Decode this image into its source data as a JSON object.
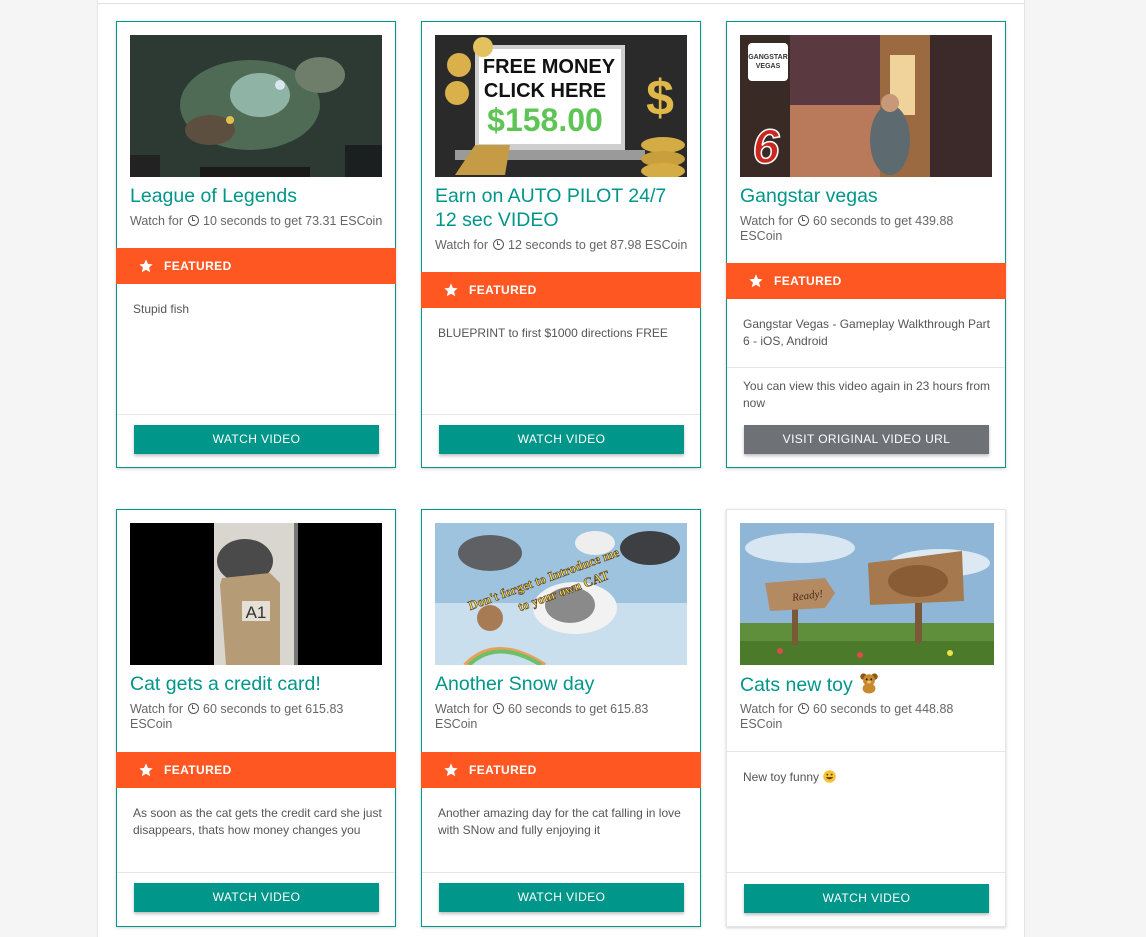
{
  "cards": [
    {
      "title": "League of Legends",
      "watch": [
        "Watch for",
        "10 seconds to get 73.31 ESCoin"
      ],
      "featured_label": "FEATURED",
      "description": "Stupid fish",
      "button": "WATCH VIDEO"
    },
    {
      "title": "Earn on AUTO PILOT 24/7 12 sec VIDEO",
      "watch": [
        "Watch for",
        "12 seconds to get 87.98 ESCoin"
      ],
      "featured_label": "FEATURED",
      "description": "BLUEPRINT to first $1000 directions FREE",
      "button": "WATCH VIDEO",
      "thumb_text": [
        "FREE MONEY",
        "CLICK HERE",
        "$158.00"
      ]
    },
    {
      "title": "Gangstar vegas",
      "watch": [
        "Watch for",
        "60 seconds to get 439.88 ESCoin"
      ],
      "featured_label": "FEATURED",
      "description": "Gangstar Vegas - Gameplay Walkthrough Part 6 - iOS, Android",
      "note": "You can view this video again in 23 hours from now",
      "button": "VISIT ORIGINAL VIDEO URL",
      "thumb_text": [
        "GANGSTAR",
        "VEGAS",
        "6"
      ]
    },
    {
      "title": "Cat gets a credit card!",
      "watch": [
        "Watch for",
        "60 seconds to get 615.83 ESCoin"
      ],
      "featured_label": "FEATURED",
      "description": "As soon as the cat gets the credit card she just disappears, thats how money changes you",
      "button": "WATCH VIDEO",
      "thumb_text": [
        "A1"
      ]
    },
    {
      "title": "Another Snow day",
      "watch": [
        "Watch for",
        "60 seconds to get 615.83 ESCoin"
      ],
      "featured_label": "FEATURED",
      "description": "Another amazing day for the cat falling in love with SNow and fully enjoying it",
      "button": "WATCH VIDEO",
      "thumb_text": [
        "Don't forget to Introduce me",
        "to your own CAT"
      ]
    },
    {
      "title": "Cats new toy",
      "title_emoji": "teddy-bear-icon",
      "watch": [
        "Watch for",
        "60 seconds to get 448.88 ESCoin"
      ],
      "description": "New toy funny",
      "description_emoji": "grinning-face-icon",
      "button": "WATCH VIDEO",
      "thumb_text": [
        "Ready!"
      ]
    }
  ],
  "colors": {
    "accent": "#00968a",
    "featured": "#ff5722",
    "grey_button": "#6e7277"
  }
}
